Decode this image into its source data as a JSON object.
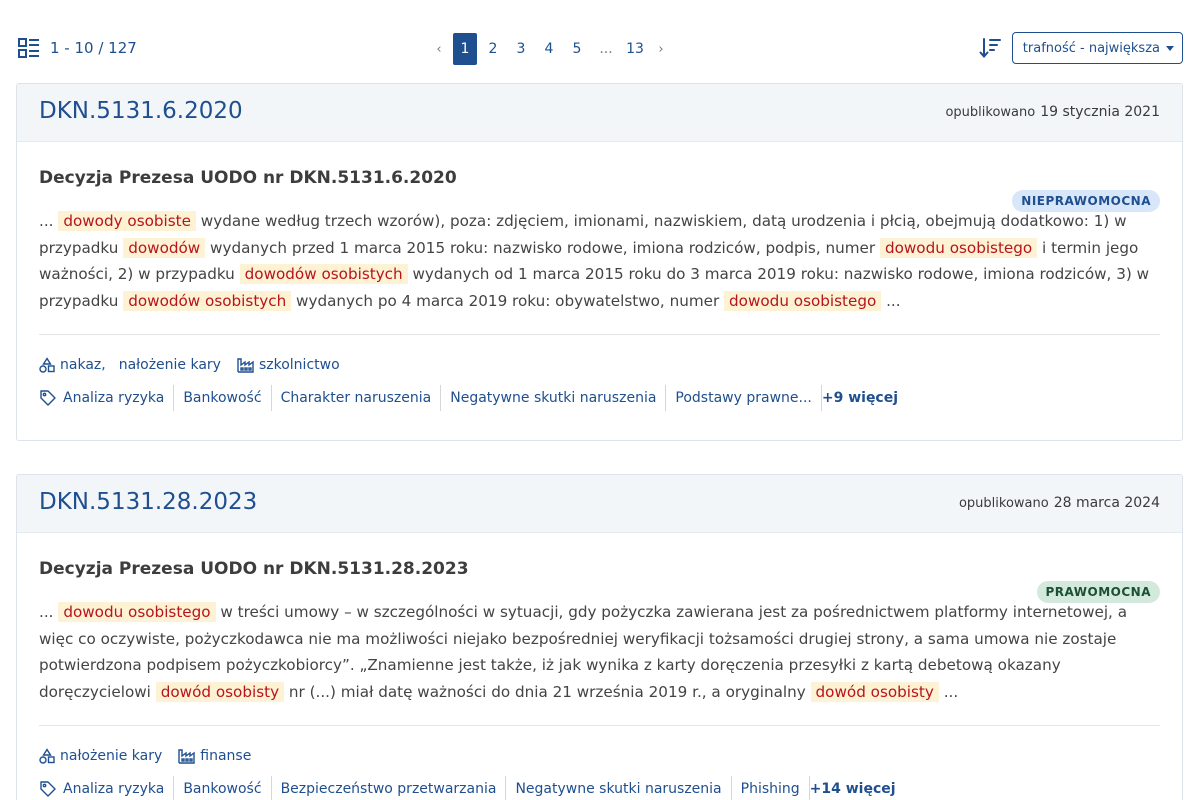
{
  "results": {
    "range": "1 - 10 / 127"
  },
  "pagination": {
    "prev": "‹",
    "next": "›",
    "pages": [
      "1",
      "2",
      "3",
      "4",
      "5"
    ],
    "ellipsis": "...",
    "last": "13",
    "current": "1"
  },
  "sort": {
    "label": "trafność - największa"
  },
  "cards": [
    {
      "id": "DKN.5131.6.2020",
      "published_label": "opublikowano",
      "published_date": "19 stycznia 2021",
      "title": "Decyzja Prezesa UODO nr DKN.5131.6.2020",
      "status": "NIEPRAWOMOCNA",
      "excerpt": [
        {
          "t": "... "
        },
        {
          "t": "dowody osobiste",
          "hl": true
        },
        {
          "t": " wydane według trzech wzorów), poza: zdjęciem, imionami, nazwiskiem, datą urodzenia i płcią, obejmują dodatkowo: 1) w przypadku "
        },
        {
          "t": "dowodów",
          "hl": true
        },
        {
          "t": " wydanych przed 1 marca 2015 roku: nazwisko rodowe, imiona rodziców, podpis, numer "
        },
        {
          "t": "dowodu osobistego",
          "hl": true
        },
        {
          "t": " i termin jego ważności, 2) w przypadku "
        },
        {
          "t": "dowodów osobistych",
          "hl": true
        },
        {
          "t": " wydanych od 1 marca 2015 roku do 3 marca 2019 roku: nazwisko rodowe, imiona rodziców, 3) w przypadku "
        },
        {
          "t": "dowodów osobistych",
          "hl": true
        },
        {
          "t": " wydanych po 4 marca 2019 roku: obywatelstwo, numer "
        },
        {
          "t": "dowodu osobistego",
          "hl": true
        },
        {
          "t": " ..."
        }
      ],
      "measures": [
        "nakaz,",
        "nałożenie kary"
      ],
      "sector": "szkolnictwo",
      "tags": [
        "Analiza ryzyka",
        "Bankowość",
        "Charakter naruszenia",
        "Negatywne skutki naruszenia",
        "Podstawy prawne..."
      ],
      "more": "+9 więcej"
    },
    {
      "id": "DKN.5131.28.2023",
      "published_label": "opublikowano",
      "published_date": "28 marca 2024",
      "title": "Decyzja Prezesa UODO nr DKN.5131.28.2023",
      "status": "PRAWOMOCNA",
      "excerpt": [
        {
          "t": "... "
        },
        {
          "t": "dowodu osobistego",
          "hl": true
        },
        {
          "t": " w treści umowy – w szczególności w sytuacji, gdy pożyczka zawierana jest za pośrednictwem platformy internetowej, a więc co oczywiste, pożyczkodawca nie ma możliwości niejako bezpośredniej weryfikacji tożsamości drugiej strony, a sama umowa nie zostaje potwierdzona podpisem pożyczkobiorcy”. „Znamienne jest także, iż jak wynika z karty doręczenia przesyłki z kartą debetową okazany doręczycielowi "
        },
        {
          "t": "dowód osobisty",
          "hl": true
        },
        {
          "t": " nr (...) miał datę ważności do dnia 21 września 2019 r., a oryginalny "
        },
        {
          "t": "dowód osobisty",
          "hl": true
        },
        {
          "t": " ..."
        }
      ],
      "measures": [
        "nałożenie kary"
      ],
      "sector": "finanse",
      "tags": [
        "Analiza ryzyka",
        "Bankowość",
        "Bezpieczeństwo przetwarzania",
        "Negatywne skutki naruszenia",
        "Phishing"
      ],
      "more": "+14 więcej"
    }
  ],
  "colors": {
    "accent": "#1f4f8f",
    "highlight_bg": "#fdf3d4",
    "highlight_text": "#b8141b",
    "badge_nie_bg": "#d7e6f8",
    "badge_pra_bg": "#d3e9dc"
  },
  "icons": {
    "results": "list-view-icon",
    "sort": "sort-descending-icon",
    "measures": "shapes-icon",
    "sector": "factory-icon",
    "tags": "tag-icon"
  }
}
